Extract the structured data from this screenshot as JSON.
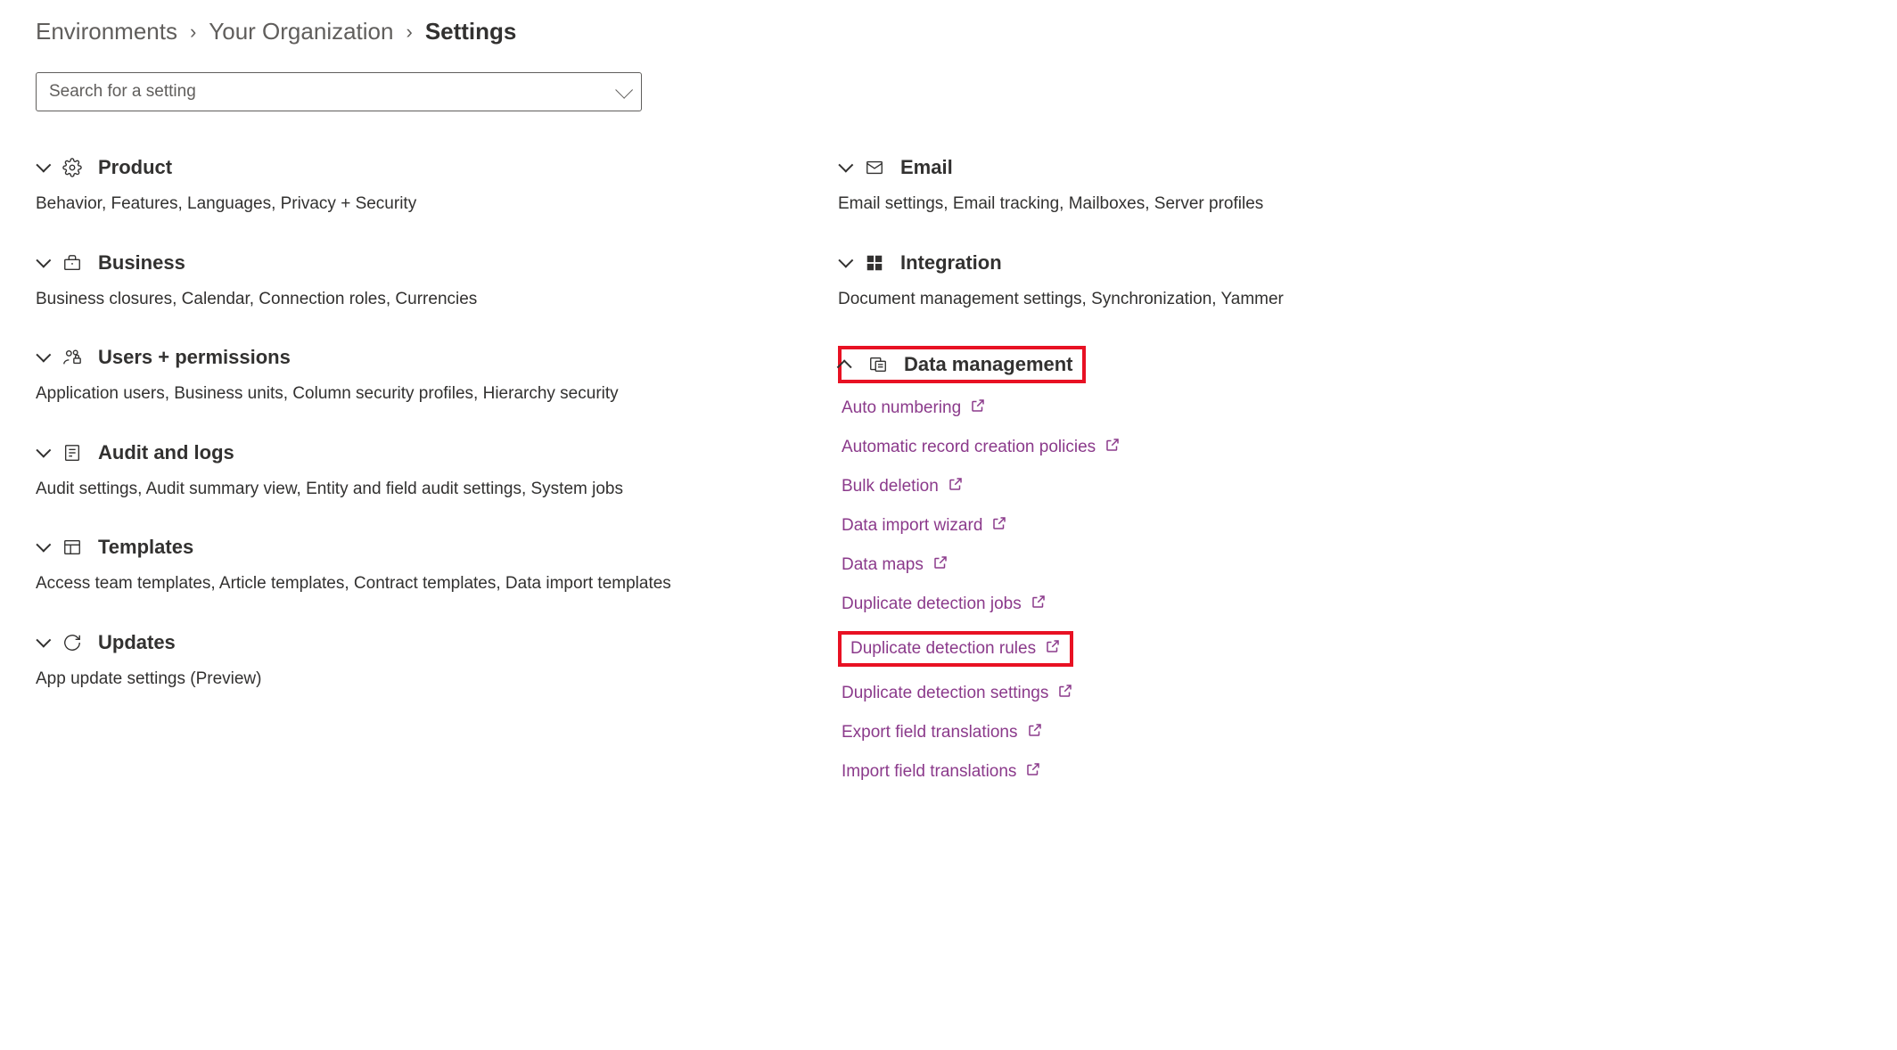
{
  "breadcrumb": {
    "items": [
      "Environments",
      "Your Organization"
    ],
    "current": "Settings"
  },
  "search": {
    "placeholder": "Search for a setting"
  },
  "left_sections": [
    {
      "title": "Product",
      "desc": "Behavior, Features, Languages, Privacy + Security"
    },
    {
      "title": "Business",
      "desc": "Business closures, Calendar, Connection roles, Currencies"
    },
    {
      "title": "Users + permissions",
      "desc": "Application users, Business units, Column security profiles, Hierarchy security"
    },
    {
      "title": "Audit and logs",
      "desc": "Audit settings, Audit summary view, Entity and field audit settings, System jobs"
    },
    {
      "title": "Templates",
      "desc": "Access team templates, Article templates, Contract templates, Data import templates"
    },
    {
      "title": "Updates",
      "desc": "App update settings (Preview)"
    }
  ],
  "right_sections": {
    "email": {
      "title": "Email",
      "desc": "Email settings, Email tracking, Mailboxes, Server profiles"
    },
    "integration": {
      "title": "Integration",
      "desc": "Document management settings, Synchronization, Yammer"
    },
    "data_mgmt": {
      "title": "Data management",
      "links": [
        "Auto numbering",
        "Automatic record creation policies",
        "Bulk deletion",
        "Data import wizard",
        "Data maps",
        "Duplicate detection jobs",
        "Duplicate detection rules",
        "Duplicate detection settings",
        "Export field translations",
        "Import field translations"
      ]
    }
  }
}
